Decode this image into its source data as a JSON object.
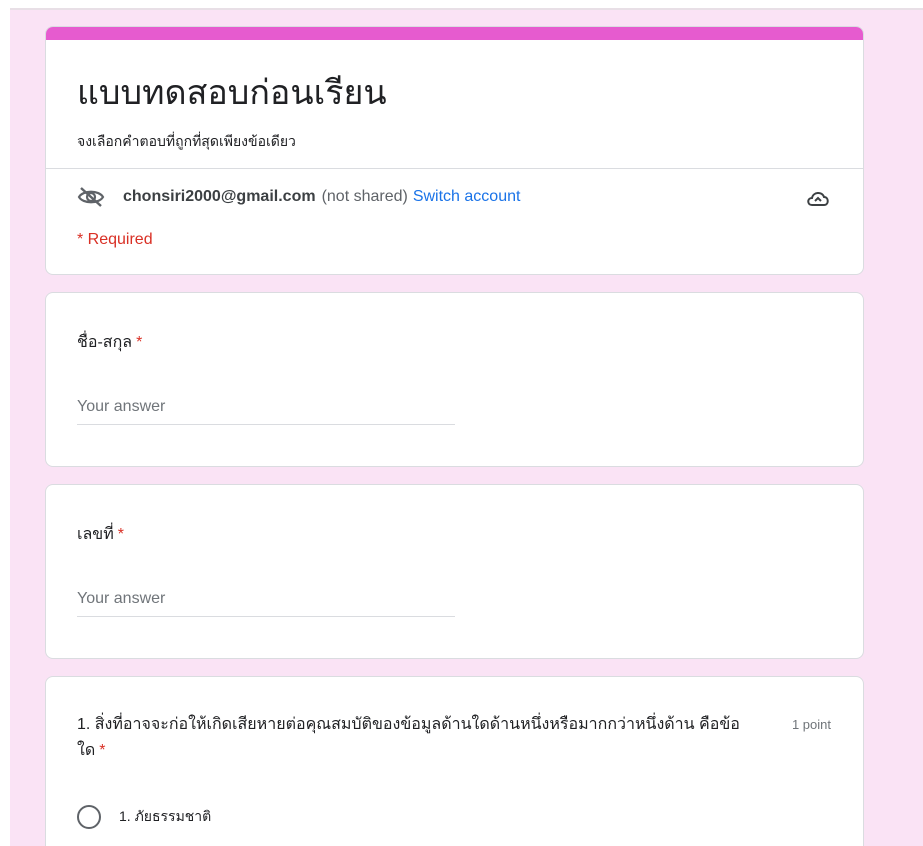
{
  "form": {
    "title": "แบบทดสอบก่อนเรียน",
    "description": "จงเลือกคำตอบที่ถูกที่สุดเพียงข้อเดียว",
    "account_email": "chonsiri2000@gmail.com",
    "not_shared": "(not shared)",
    "switch_account": "Switch account",
    "required_note": "* Required",
    "accent_color": "#e65bcf",
    "background_color": "#fae3f5"
  },
  "questions": [
    {
      "label": "ชื่อ-สกุล",
      "required_mark": "*",
      "placeholder": "Your answer"
    },
    {
      "label": "เลขที่",
      "required_mark": "*",
      "placeholder": "Your answer"
    }
  ],
  "mcq": {
    "text": "1. สิ่งที่อาจจะก่อให้เกิดเสียหายต่อคุณสมบัติของข้อมูลด้านใดด้านหนึ่งหรือมากกว่าหนึ่งด้าน คือข้อใด",
    "required_mark": "*",
    "points": "1 point",
    "options": [
      "1. ภัยธรรมชาติ"
    ]
  },
  "icons": {
    "visibility": "eye-off-icon",
    "cloud": "cloud-sync-icon",
    "radio": "radio-unchecked-icon"
  }
}
